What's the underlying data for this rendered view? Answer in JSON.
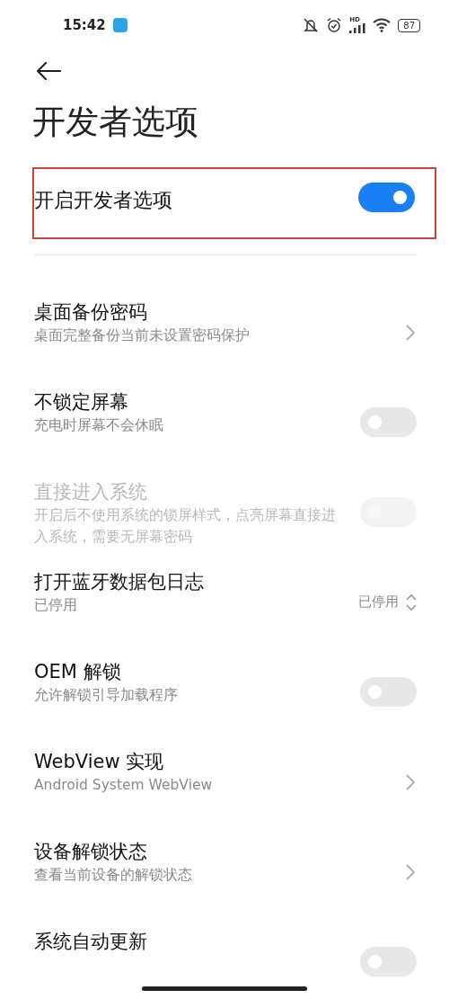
{
  "status_bar": {
    "time": "15:42",
    "signal_label": "HD",
    "battery": "87"
  },
  "title": "开发者选项",
  "master": {
    "label": "开启开发者选项",
    "on": true
  },
  "items": [
    {
      "kind": "chevron",
      "title": "桌面备份密码",
      "subtitle": "桌面完整备份当前未设置密码保护",
      "disabled": false
    },
    {
      "kind": "switch",
      "title": "不锁定屏幕",
      "subtitle": "充电时屏幕不会休眠",
      "on": false,
      "disabled": false
    },
    {
      "kind": "switch",
      "title": "直接进入系统",
      "subtitle": "开启后不使用系统的锁屏样式，点亮屏幕直接进入系统，需要无屏幕密码",
      "on": false,
      "disabled": true
    },
    {
      "kind": "select",
      "title": "打开蓝牙数据包日志",
      "subtitle": "已停用",
      "value": "已停用",
      "disabled": false
    },
    {
      "kind": "switch",
      "title": "OEM 解锁",
      "subtitle": "允许解锁引导加载程序",
      "on": false,
      "disabled": false
    },
    {
      "kind": "chevron",
      "title": "WebView 实现",
      "subtitle": "Android System WebView",
      "disabled": false
    },
    {
      "kind": "chevron",
      "title": "设备解锁状态",
      "subtitle": "查看当前设备的解锁状态",
      "disabled": false
    },
    {
      "kind": "switch",
      "title": "系统自动更新",
      "on": false,
      "disabled": false
    }
  ]
}
